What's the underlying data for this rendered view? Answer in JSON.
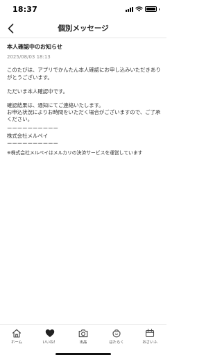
{
  "status_bar": {
    "time": "18:37"
  },
  "header": {
    "title": "個別メッセージ"
  },
  "message": {
    "title": "本人確認中のお知らせ",
    "date": "2025/08/03 18:13",
    "paragraph1": "このたびは、アプリでかんたん本人確認にお申し込みいただきありがとうございます。",
    "paragraph2": "ただいま本人確認中です。",
    "paragraph3": "確認結果は、通知にてご連絡いたします。\nお申込状況によりお時間をいただく場合がございますので、ご了承ください。",
    "divider": "ーーーーーーーーーー",
    "company": "株式会社メルペイ",
    "notice": "※株式会社メルペイはメルカリの決済サービスを運営しています"
  },
  "tab_bar": {
    "tabs": [
      {
        "label": "ホーム",
        "icon": "home-icon"
      },
      {
        "label": "いいね！",
        "icon": "heart-icon"
      },
      {
        "label": "出品",
        "icon": "camera-icon"
      },
      {
        "label": "はたらく",
        "icon": "bag-icon"
      },
      {
        "label": "おさいふ",
        "icon": "wallet-icon"
      }
    ]
  }
}
